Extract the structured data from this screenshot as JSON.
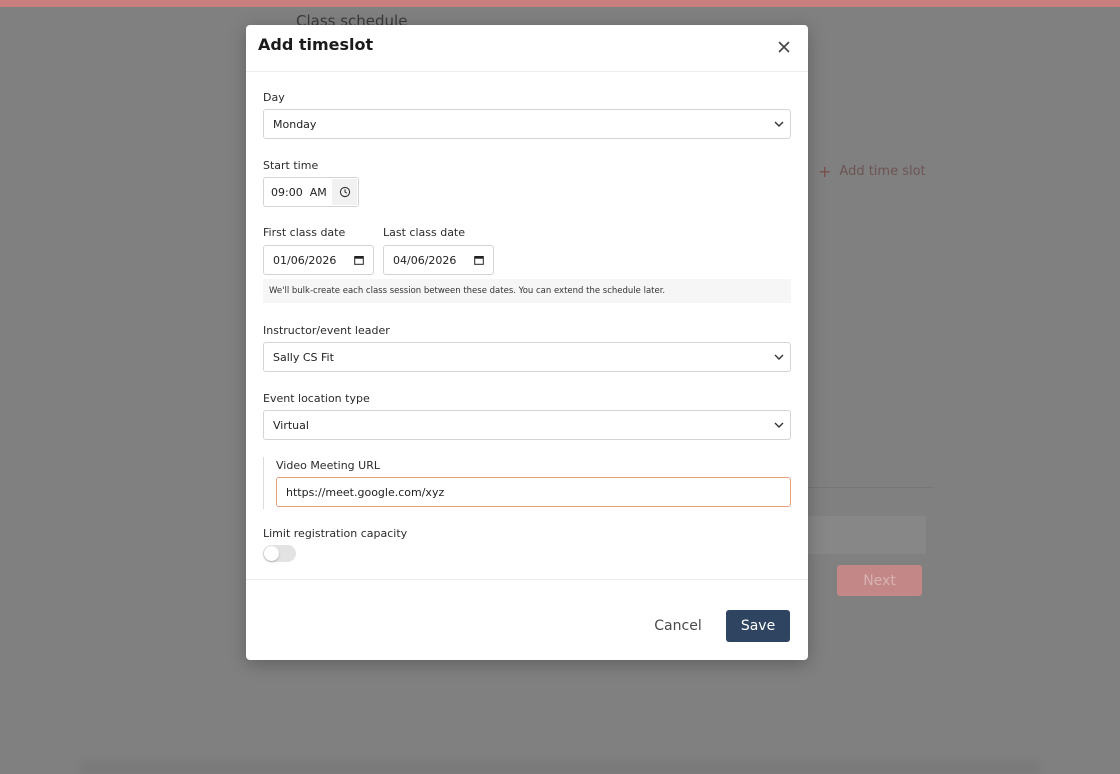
{
  "background": {
    "page_title": "Class schedule",
    "add_time_slot_label": "Add time slot",
    "next_label": "Next"
  },
  "modal": {
    "title": "Add timeslot",
    "day": {
      "label": "Day",
      "value": "Monday"
    },
    "start_time": {
      "label": "Start time",
      "value": "09:00  AM"
    },
    "first_class_date": {
      "label": "First class date",
      "value": "01/06/2026"
    },
    "last_class_date": {
      "label": "Last class date",
      "value": "04/06/2026"
    },
    "dates_hint": "We'll bulk-create each class session between these dates. You can extend the schedule later.",
    "instructor": {
      "label": "Instructor/event leader",
      "value": "Sally CS Fit"
    },
    "location_type": {
      "label": "Event location type",
      "value": "Virtual"
    },
    "video_url": {
      "label": "Video Meeting URL",
      "value": "https://meet.google.com/xyz"
    },
    "limit_capacity": {
      "label": "Limit registration capacity",
      "enabled": false
    },
    "cancel_label": "Cancel",
    "save_label": "Save"
  },
  "colors": {
    "save_button": "#2f4461",
    "url_focus_border": "#e7a27a",
    "overlay": "#808080"
  }
}
